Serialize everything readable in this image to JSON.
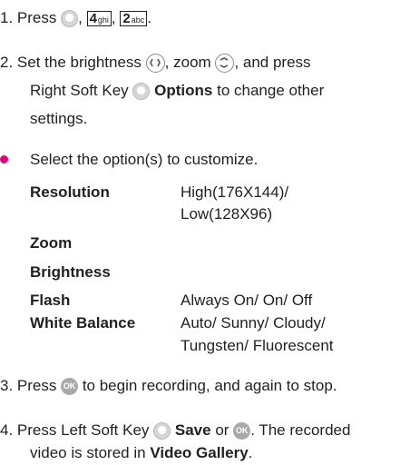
{
  "steps": {
    "s1_prefix": "1. Press",
    "s1_comma1": ",",
    "s1_key4": "4",
    "s1_key4_letters": "ghi",
    "s1_comma2": ",",
    "s1_key2": "2",
    "s1_key2_letters": "abc",
    "s1_end": ".",
    "s2_a": "2. Set the brightness",
    "s2_b": ", zoom",
    "s2_c": ", and press",
    "s2_line2_a": "Right Soft Key",
    "s2_line2_bold": "Options",
    "s2_line2_b": "to change other",
    "s2_line3": "settings.",
    "bullet_text": "Select the option(s) to customize.",
    "s3_a": "3. Press",
    "s3_b": "to begin recording, and again to stop.",
    "s4_a": "4. Press Left Soft Key",
    "s4_bold1": "Save",
    "s4_b": "or",
    "s4_c": ". The recorded",
    "s4_line2_a": "video is stored in",
    "s4_line2_bold": "Video Gallery",
    "s4_line2_end": ".",
    "ok_label": "OK"
  },
  "options": [
    {
      "name": "Resolution",
      "value_line1": "High(176X144)/",
      "value_line2": "Low(128X96)"
    },
    {
      "name": "Zoom",
      "value_line1": "",
      "value_line2": ""
    },
    {
      "name": "Brightness",
      "value_line1": "",
      "value_line2": ""
    },
    {
      "name": "Flash",
      "value_line1": "Always On/ On/ Off",
      "value_line2": ""
    },
    {
      "name": "White Balance",
      "value_line1": "Auto/ Sunny/ Cloudy/",
      "value_line2": "Tungsten/ Fluorescent"
    }
  ],
  "colors": {
    "bullet": "#e2007a",
    "text": "#231f20",
    "ok_key": "#a9a9a9"
  },
  "icons": [
    "soft-key-icon",
    "nav-left-right-icon",
    "nav-up-down-icon",
    "ok-key-icon"
  ]
}
